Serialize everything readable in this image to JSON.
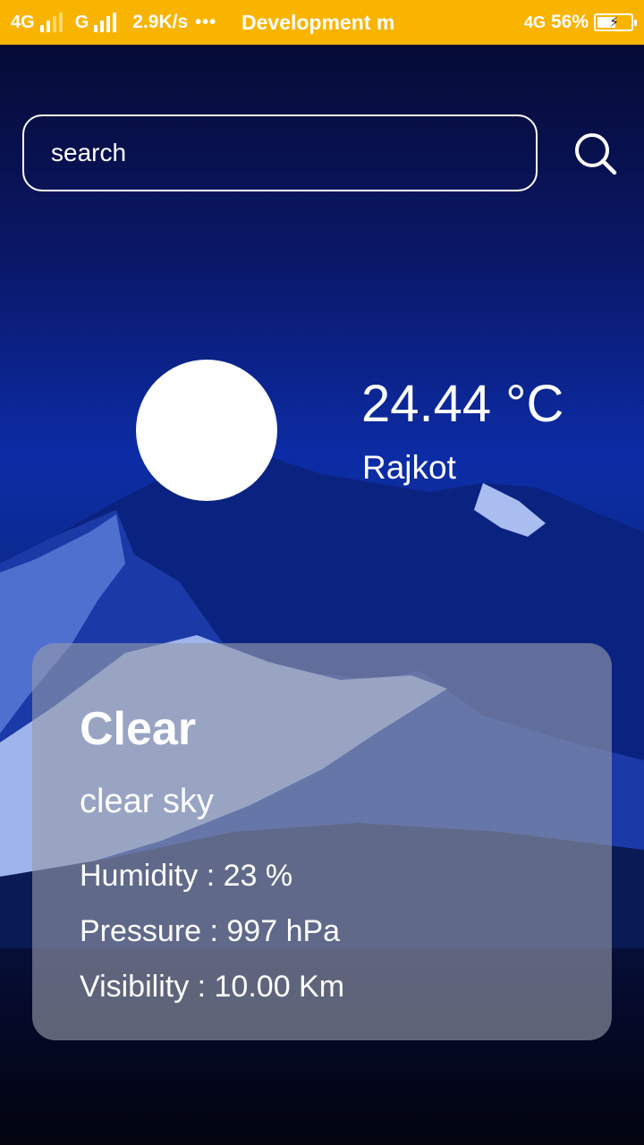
{
  "status_bar": {
    "network1": "4G",
    "network2": "G",
    "speed": "2.9K/s",
    "more": "•••",
    "app_title": "Development m",
    "network3": "4G",
    "battery_percent": "56%",
    "battery_level": 0.56
  },
  "search": {
    "placeholder": "search",
    "button_icon": "search-icon"
  },
  "weather": {
    "icon": "sun-icon",
    "temperature": "24.44 °C",
    "city": "Rajkot"
  },
  "details": {
    "main": "Clear",
    "description": "clear sky",
    "humidity": "Humidity : 23 %",
    "pressure": "Pressure : 997 hPa",
    "visibility": "Visibility : 10.00 Km"
  },
  "colors": {
    "status_bar": "#f9b400",
    "card": "#969baa",
    "text": "#ffffff"
  }
}
